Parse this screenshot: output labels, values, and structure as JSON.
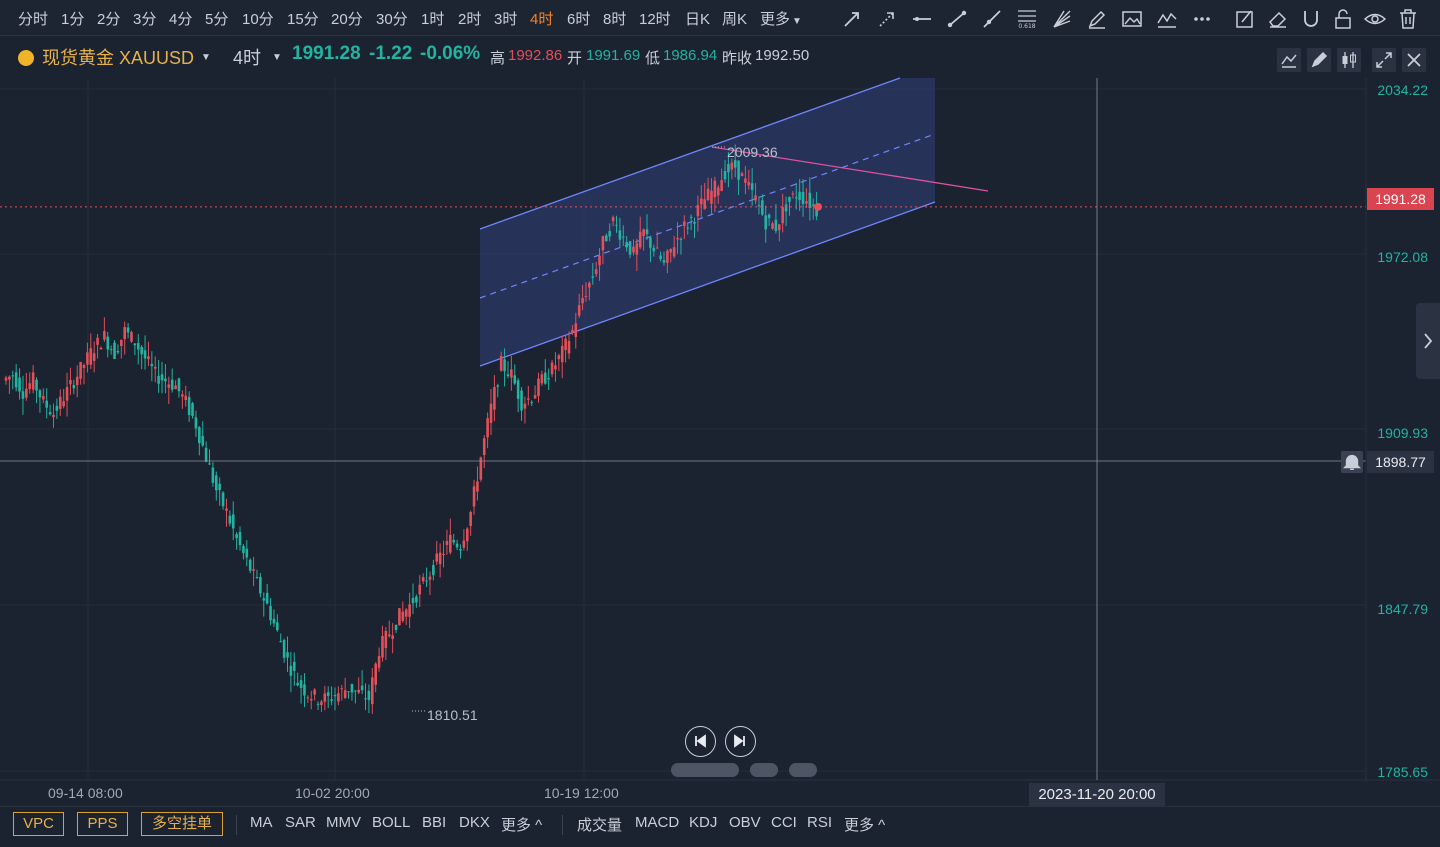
{
  "timeframes": [
    "分时",
    "1分",
    "2分",
    "3分",
    "4分",
    "5分",
    "10分",
    "15分",
    "20分",
    "30分",
    "1时",
    "2时",
    "3时",
    "4时",
    "6时",
    "8时",
    "12时",
    "日K",
    "周K",
    "更多"
  ],
  "active_timeframe": "4时",
  "symbol": {
    "name": "现货黄金 XAUUSD",
    "interval": "4时"
  },
  "quote": {
    "last": "1991.28",
    "change": "-1.22",
    "change_pct": "-0.06%",
    "high_label": "高",
    "high": "1992.86",
    "open_label": "开",
    "open": "1991.69",
    "low_label": "低",
    "low": "1986.94",
    "prev_label": "昨收",
    "prev": "1992.50"
  },
  "price_axis": [
    "2034.22",
    "1972.08",
    "1909.93",
    "1847.79",
    "1785.65"
  ],
  "current_price_tag": "1991.28",
  "crosshair_price_tag": "1898.77",
  "crosshair_time_tag": "2023-11-20 20:00",
  "time_axis": [
    "09-14 08:00",
    "10-02 20:00",
    "10-19 12:00"
  ],
  "annotations": {
    "high_mark": "2009.36",
    "low_mark": "1810.51"
  },
  "bottom_left_buttons": [
    "VPC",
    "PPS",
    "多空挂单"
  ],
  "main_indicators": [
    "MA",
    "SAR",
    "MMV",
    "BOLL",
    "BBI",
    "DKX",
    "更多 ^"
  ],
  "sub_indicators": [
    "成交量",
    "MACD",
    "KDJ",
    "OBV",
    "CCI",
    "RSI",
    "更多 ^"
  ],
  "colors": {
    "up": "#e2505a",
    "down": "#23b3a1",
    "accent": "#f5812a",
    "channel": "#6f86ff",
    "trendline": "#e052a0"
  },
  "chart_data": {
    "type": "candlestick",
    "ylim": [
      1785.65,
      2040
    ],
    "ohlc_close_path": [
      1930,
      1924,
      1928,
      1920,
      1916,
      1922,
      1928,
      1934,
      1940,
      1944,
      1938,
      1946,
      1942,
      1936,
      1930,
      1928,
      1926,
      1920,
      1912,
      1900,
      1888,
      1880,
      1870,
      1862,
      1854,
      1846,
      1836,
      1826,
      1818,
      1814,
      1812,
      1812,
      1814,
      1816,
      1814,
      1812,
      1830,
      1836,
      1842,
      1846,
      1852,
      1858,
      1864,
      1870,
      1868,
      1880,
      1900,
      1918,
      1934,
      1930,
      1920,
      1922,
      1928,
      1932,
      1938,
      1946,
      1958,
      1966,
      1978,
      1986,
      1980,
      1974,
      1982,
      1976,
      1970,
      1978,
      1984,
      1988,
      1994,
      1998,
      2004,
      2006,
      2000,
      1994,
      1986,
      1984,
      1992,
      1996,
      1994,
      1990
    ],
    "high_marker": 2009.36,
    "low_marker": 1810.51,
    "last": 1991.28
  }
}
